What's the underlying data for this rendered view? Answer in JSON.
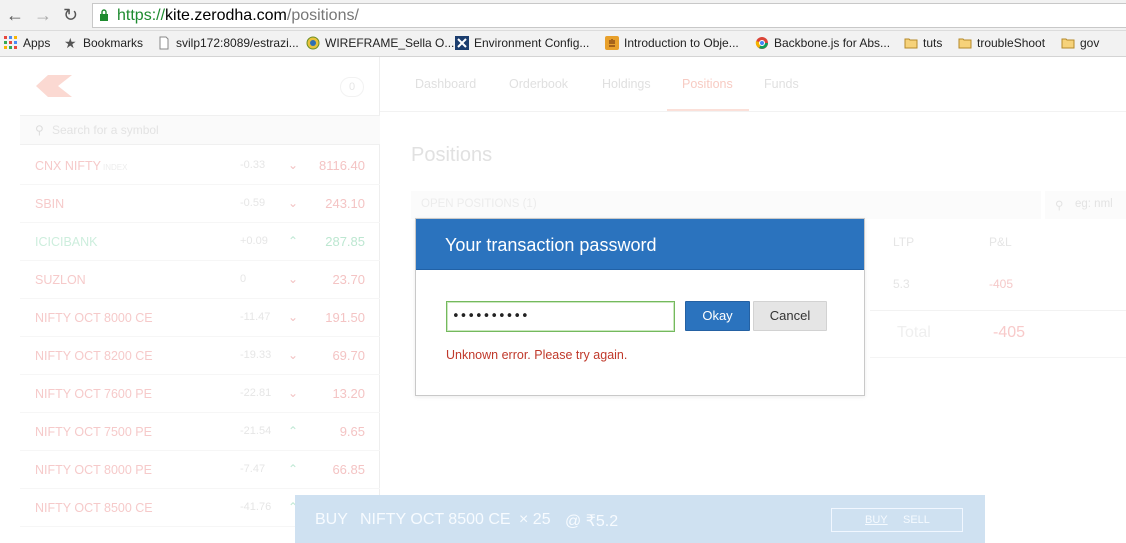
{
  "browser": {
    "url_scheme": "https://",
    "url_host": "kite.zerodha.com",
    "url_path": "/positions/",
    "bookmarks": [
      {
        "label": "Apps",
        "icon": "apps-grid-icon"
      },
      {
        "label": "Bookmarks",
        "icon": "star-icon"
      },
      {
        "label": "svilp172:8089/estrazi...",
        "icon": "page-icon"
      },
      {
        "label": "WIREFRAME_Sella O...",
        "icon": "globe-icon"
      },
      {
        "label": "Environment Config...",
        "icon": "x-logo-icon"
      },
      {
        "label": "Introduction to Obje...",
        "icon": "java-icon"
      },
      {
        "label": "Backbone.js for Abs...",
        "icon": "chrome-icon"
      },
      {
        "label": "tuts",
        "icon": "folder-icon"
      },
      {
        "label": "troubleShoot",
        "icon": "folder-icon"
      },
      {
        "label": "gov",
        "icon": "folder-icon"
      }
    ]
  },
  "sidebar": {
    "badge": "0",
    "search_placeholder": "Search for a symbol",
    "watchlist": [
      {
        "name": "CNX NIFTY",
        "tag": "INDEX",
        "change": "-0.33",
        "direction": "down",
        "price": "8116.40"
      },
      {
        "name": "SBIN",
        "tag": "",
        "change": "-0.59",
        "direction": "down",
        "price": "243.10"
      },
      {
        "name": "ICICIBANK",
        "tag": "",
        "change": "+0.09",
        "direction": "up",
        "price": "287.85"
      },
      {
        "name": "SUZLON",
        "tag": "",
        "change": "0",
        "direction": "down",
        "price": "23.70"
      },
      {
        "name": "NIFTY OCT 8000 CE",
        "tag": "",
        "change": "-11.47",
        "direction": "down",
        "price": "191.50"
      },
      {
        "name": "NIFTY OCT 8200 CE",
        "tag": "",
        "change": "-19.33",
        "direction": "down",
        "price": "69.70"
      },
      {
        "name": "NIFTY OCT 7600 PE",
        "tag": "",
        "change": "-22.81",
        "direction": "down",
        "price": "13.20"
      },
      {
        "name": "NIFTY OCT 7500 PE",
        "tag": "",
        "change": "-21.54",
        "direction": "up",
        "price": "9.65"
      },
      {
        "name": "NIFTY OCT 8000 PE",
        "tag": "",
        "change": "-7.47",
        "direction": "up",
        "price": "66.85"
      },
      {
        "name": "NIFTY OCT 8500 CE",
        "tag": "",
        "change": "-41.76",
        "direction": "up",
        "price": ""
      }
    ]
  },
  "nav": {
    "tabs": [
      "Dashboard",
      "Orderbook",
      "Holdings",
      "Positions",
      "Funds"
    ],
    "active": "Positions"
  },
  "positions": {
    "title": "Positions",
    "open_label": "OPEN POSITIONS (1)",
    "filter_placeholder": "eg: nml",
    "col_ltp": "LTP",
    "col_pnl": "P&L",
    "row_ltp": "5.3",
    "row_pnl": "-405",
    "total_label": "Total",
    "total_value": "-405"
  },
  "order_bar": {
    "side": "BUY",
    "instrument": "NIFTY OCT 8500 CE",
    "qty": "× 25",
    "price": "@ ₹5.2",
    "buy_label": "BUY",
    "sell_label": "SELL"
  },
  "modal": {
    "title": "Your transaction password",
    "password_masked": "••••••••••",
    "okay_label": "Okay",
    "cancel_label": "Cancel",
    "error": "Unknown error. Please try again."
  }
}
